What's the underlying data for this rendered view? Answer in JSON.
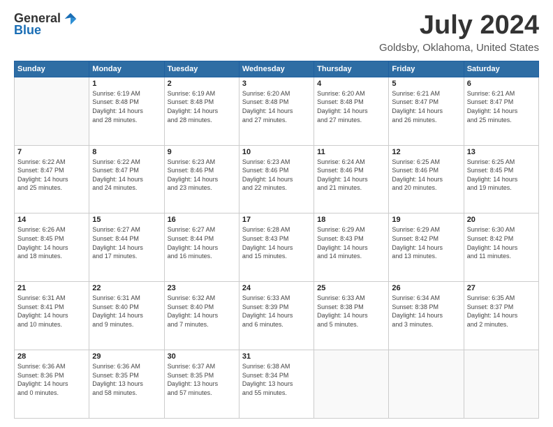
{
  "logo": {
    "general": "General",
    "blue": "Blue"
  },
  "title": "July 2024",
  "location": "Goldsby, Oklahoma, United States",
  "days_header": [
    "Sunday",
    "Monday",
    "Tuesday",
    "Wednesday",
    "Thursday",
    "Friday",
    "Saturday"
  ],
  "weeks": [
    [
      {
        "day": "",
        "info": ""
      },
      {
        "day": "1",
        "info": "Sunrise: 6:19 AM\nSunset: 8:48 PM\nDaylight: 14 hours\nand 28 minutes."
      },
      {
        "day": "2",
        "info": "Sunrise: 6:19 AM\nSunset: 8:48 PM\nDaylight: 14 hours\nand 28 minutes."
      },
      {
        "day": "3",
        "info": "Sunrise: 6:20 AM\nSunset: 8:48 PM\nDaylight: 14 hours\nand 27 minutes."
      },
      {
        "day": "4",
        "info": "Sunrise: 6:20 AM\nSunset: 8:48 PM\nDaylight: 14 hours\nand 27 minutes."
      },
      {
        "day": "5",
        "info": "Sunrise: 6:21 AM\nSunset: 8:47 PM\nDaylight: 14 hours\nand 26 minutes."
      },
      {
        "day": "6",
        "info": "Sunrise: 6:21 AM\nSunset: 8:47 PM\nDaylight: 14 hours\nand 25 minutes."
      }
    ],
    [
      {
        "day": "7",
        "info": "Sunrise: 6:22 AM\nSunset: 8:47 PM\nDaylight: 14 hours\nand 25 minutes."
      },
      {
        "day": "8",
        "info": "Sunrise: 6:22 AM\nSunset: 8:47 PM\nDaylight: 14 hours\nand 24 minutes."
      },
      {
        "day": "9",
        "info": "Sunrise: 6:23 AM\nSunset: 8:46 PM\nDaylight: 14 hours\nand 23 minutes."
      },
      {
        "day": "10",
        "info": "Sunrise: 6:23 AM\nSunset: 8:46 PM\nDaylight: 14 hours\nand 22 minutes."
      },
      {
        "day": "11",
        "info": "Sunrise: 6:24 AM\nSunset: 8:46 PM\nDaylight: 14 hours\nand 21 minutes."
      },
      {
        "day": "12",
        "info": "Sunrise: 6:25 AM\nSunset: 8:46 PM\nDaylight: 14 hours\nand 20 minutes."
      },
      {
        "day": "13",
        "info": "Sunrise: 6:25 AM\nSunset: 8:45 PM\nDaylight: 14 hours\nand 19 minutes."
      }
    ],
    [
      {
        "day": "14",
        "info": "Sunrise: 6:26 AM\nSunset: 8:45 PM\nDaylight: 14 hours\nand 18 minutes."
      },
      {
        "day": "15",
        "info": "Sunrise: 6:27 AM\nSunset: 8:44 PM\nDaylight: 14 hours\nand 17 minutes."
      },
      {
        "day": "16",
        "info": "Sunrise: 6:27 AM\nSunset: 8:44 PM\nDaylight: 14 hours\nand 16 minutes."
      },
      {
        "day": "17",
        "info": "Sunrise: 6:28 AM\nSunset: 8:43 PM\nDaylight: 14 hours\nand 15 minutes."
      },
      {
        "day": "18",
        "info": "Sunrise: 6:29 AM\nSunset: 8:43 PM\nDaylight: 14 hours\nand 14 minutes."
      },
      {
        "day": "19",
        "info": "Sunrise: 6:29 AM\nSunset: 8:42 PM\nDaylight: 14 hours\nand 13 minutes."
      },
      {
        "day": "20",
        "info": "Sunrise: 6:30 AM\nSunset: 8:42 PM\nDaylight: 14 hours\nand 11 minutes."
      }
    ],
    [
      {
        "day": "21",
        "info": "Sunrise: 6:31 AM\nSunset: 8:41 PM\nDaylight: 14 hours\nand 10 minutes."
      },
      {
        "day": "22",
        "info": "Sunrise: 6:31 AM\nSunset: 8:40 PM\nDaylight: 14 hours\nand 9 minutes."
      },
      {
        "day": "23",
        "info": "Sunrise: 6:32 AM\nSunset: 8:40 PM\nDaylight: 14 hours\nand 7 minutes."
      },
      {
        "day": "24",
        "info": "Sunrise: 6:33 AM\nSunset: 8:39 PM\nDaylight: 14 hours\nand 6 minutes."
      },
      {
        "day": "25",
        "info": "Sunrise: 6:33 AM\nSunset: 8:38 PM\nDaylight: 14 hours\nand 5 minutes."
      },
      {
        "day": "26",
        "info": "Sunrise: 6:34 AM\nSunset: 8:38 PM\nDaylight: 14 hours\nand 3 minutes."
      },
      {
        "day": "27",
        "info": "Sunrise: 6:35 AM\nSunset: 8:37 PM\nDaylight: 14 hours\nand 2 minutes."
      }
    ],
    [
      {
        "day": "28",
        "info": "Sunrise: 6:36 AM\nSunset: 8:36 PM\nDaylight: 14 hours\nand 0 minutes."
      },
      {
        "day": "29",
        "info": "Sunrise: 6:36 AM\nSunset: 8:35 PM\nDaylight: 13 hours\nand 58 minutes."
      },
      {
        "day": "30",
        "info": "Sunrise: 6:37 AM\nSunset: 8:35 PM\nDaylight: 13 hours\nand 57 minutes."
      },
      {
        "day": "31",
        "info": "Sunrise: 6:38 AM\nSunset: 8:34 PM\nDaylight: 13 hours\nand 55 minutes."
      },
      {
        "day": "",
        "info": ""
      },
      {
        "day": "",
        "info": ""
      },
      {
        "day": "",
        "info": ""
      }
    ]
  ]
}
